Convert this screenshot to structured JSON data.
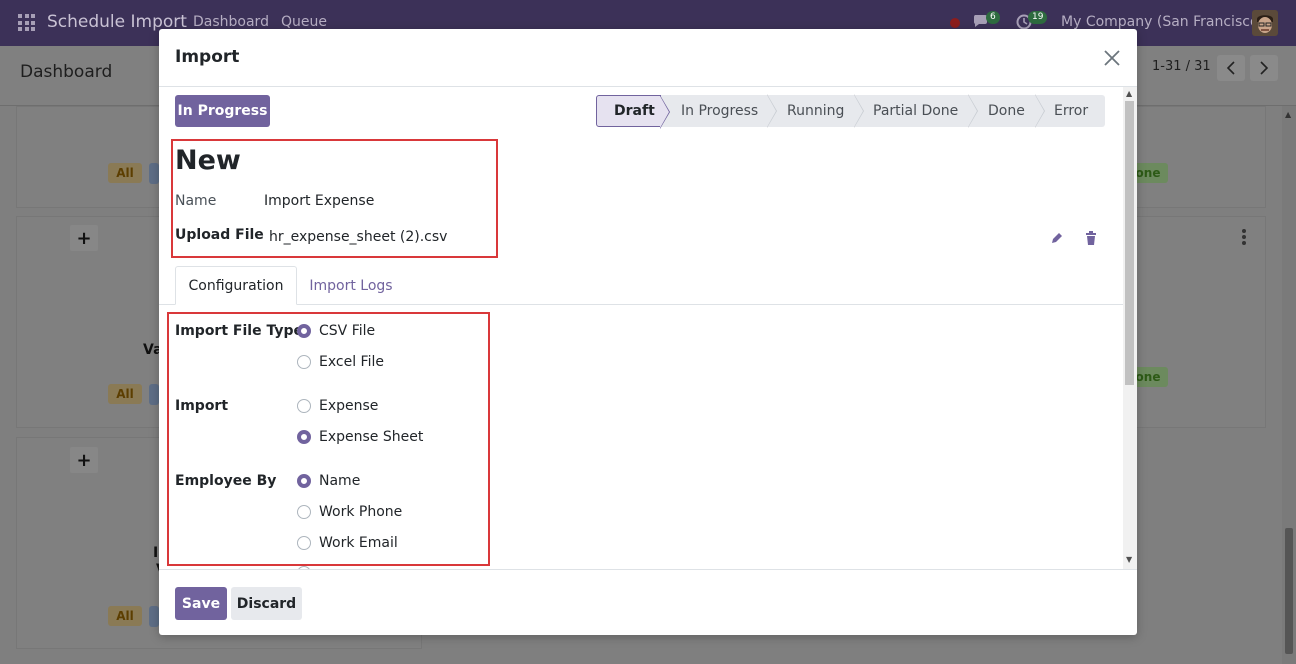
{
  "topbar": {
    "app_title": "Schedule Import",
    "menu": [
      "Dashboard",
      "Queue"
    ],
    "chat_count": "6",
    "activity_count": "19",
    "company": "My Company (San Francisco)"
  },
  "control": {
    "breadcrumb": "Dashboard",
    "pager": "1-31 / 31"
  },
  "background_cards": {
    "tag_all": "All",
    "tag_done": "one",
    "card_text_1": "Va",
    "card_text_2": "I",
    "card_text_3": "V",
    "plus": "+"
  },
  "modal": {
    "title": "Import",
    "state_button": "In Progress",
    "stages": [
      "Draft",
      "In Progress",
      "Running",
      "Partial Done",
      "Done",
      "Error"
    ],
    "active_stage": "Draft",
    "record_title": "New",
    "name_label": "Name",
    "name_value": "Import Expense",
    "upload_label": "Upload File",
    "upload_value": "hr_expense_sheet (2).csv",
    "tabs": [
      "Configuration",
      "Import Logs"
    ],
    "active_tab": "Configuration",
    "config": {
      "file_type_label": "Import File Type",
      "file_type_options": [
        "CSV File",
        "Excel File"
      ],
      "file_type_selected": "CSV File",
      "import_label": "Import",
      "import_options": [
        "Expense",
        "Expense Sheet"
      ],
      "import_selected": "Expense Sheet",
      "employee_label": "Employee By",
      "employee_options": [
        "Name",
        "Work Phone",
        "Work Email"
      ],
      "employee_selected": "Name"
    },
    "footer": {
      "save_label": "Save",
      "discard_label": "Discard"
    }
  },
  "colors": {
    "primary": "#71639e",
    "highlight_border": "#d9383a",
    "topbar": "#3c3158"
  }
}
